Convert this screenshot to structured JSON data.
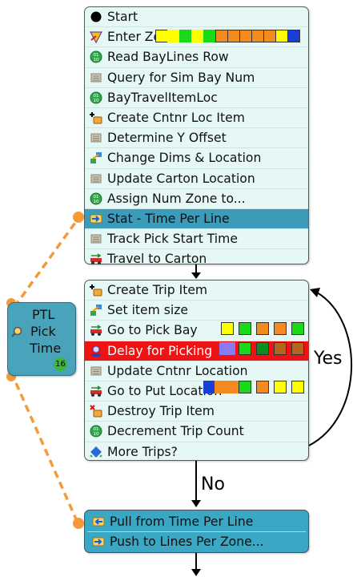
{
  "block1": {
    "rows": [
      {
        "icon": "start-circle-icon",
        "label": "Start"
      },
      {
        "icon": "enter-zone-icon",
        "label": "Enter Zone for Each Line"
      },
      {
        "icon": "read-data-icon",
        "label": "Read BayLines Row"
      },
      {
        "icon": "scroll-icon",
        "label": "Query for Sim Bay Num"
      },
      {
        "icon": "read-data-icon",
        "label": "BayTravelItemLoc"
      },
      {
        "icon": "create-item-icon",
        "label": "Create Cntnr Loc Item"
      },
      {
        "icon": "scroll-icon",
        "label": "Determine Y Offset"
      },
      {
        "icon": "change-dims-icon",
        "label": "Change Dims & Location"
      },
      {
        "icon": "scroll-icon",
        "label": "Update Carton Location"
      },
      {
        "icon": "read-data-icon",
        "label": "Assign Num Zone to..."
      },
      {
        "icon": "push-arrow-icon",
        "label": "Stat - Time Per Line"
      },
      {
        "icon": "scroll-icon",
        "label": "Track Pick Start Time"
      },
      {
        "icon": "travel-icon",
        "label": "Travel to Carton"
      }
    ]
  },
  "block2": {
    "rows": [
      {
        "icon": "create-item-icon",
        "label": "Create Trip Item"
      },
      {
        "icon": "change-dims-icon",
        "label": "Set item size"
      },
      {
        "icon": "travel-icon",
        "label": "Go to Pick Bay"
      },
      {
        "icon": "delay-icon",
        "label": "Delay for Picking"
      },
      {
        "icon": "scroll-icon",
        "label": "Update Cntnr Location"
      },
      {
        "icon": "travel-icon",
        "label": "Go to Put Location"
      },
      {
        "icon": "destroy-item-icon",
        "label": "Destroy Trip Item"
      },
      {
        "icon": "read-data-icon",
        "label": "Decrement Trip Count"
      },
      {
        "icon": "decide-icon",
        "label": "More Trips?"
      }
    ]
  },
  "block3": {
    "rows": [
      {
        "icon": "pull-arrow-icon",
        "label": "Pull from Time Per Line"
      },
      {
        "icon": "push-arrow-icon",
        "label": "Push to Lines Per Zone..."
      }
    ]
  },
  "ptl": {
    "lines": [
      "PTL",
      "Pick",
      "Time"
    ],
    "count": "16"
  },
  "labels": {
    "yes": "Yes",
    "no": "No"
  },
  "colors": {
    "block_bg": "#e6f8f6",
    "highlight": "#3c9bb9",
    "delay_row": "#ef1313",
    "ptl_box": "#48a3bb",
    "link_dash": "#f49a3a",
    "swatch_yellow": "#ffff00",
    "swatch_green": "#19d919",
    "swatch_orange": "#f28a1f",
    "swatch_blue": "#1a3fd9",
    "swatch_darkgreen": "#0a8f20",
    "swatch_brown": "#b5651d",
    "swatch_purple": "#8a7cf0"
  }
}
